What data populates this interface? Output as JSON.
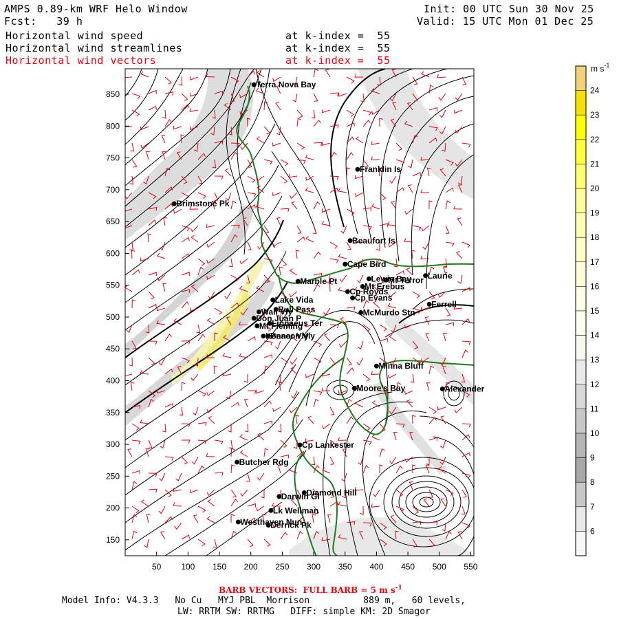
{
  "header": {
    "title_left": "AMPS 0.89-km WRF Helo Window",
    "forecast_left": "Fcst:   39 h",
    "init_right": "Init: 00 UTC Sun 30 Nov 25",
    "valid_right": "Valid: 15 UTC Mon 01 Dec 25",
    "fields": [
      {
        "name": "Horizontal wind speed",
        "level": "at k-index =  55",
        "color": "#000000"
      },
      {
        "name": "Horizontal wind streamlines",
        "level": "at k-index =  55",
        "color": "#000000"
      },
      {
        "name": "Horizontal wind vectors",
        "level": "at k-index =  55",
        "color": "#e8000b"
      }
    ]
  },
  "map": {
    "x_ticks": [
      "50",
      "100",
      "150",
      "200",
      "250",
      "300",
      "350",
      "400",
      "450",
      "500",
      "550"
    ],
    "y_ticks": [
      "150",
      "200",
      "250",
      "300",
      "350",
      "400",
      "450",
      "500",
      "550",
      "600",
      "650",
      "700",
      "750",
      "800",
      "850"
    ],
    "x_range": [
      0,
      555
    ],
    "y_range": [
      125,
      890
    ],
    "coastline_color": "#1f7a1f",
    "streamline_color": "#000000",
    "barb_color": "#e8000b",
    "stations": [
      {
        "name": "Terra Nova Bay",
        "x": 205,
        "y": 865
      },
      {
        "name": "Franklin Is",
        "x": 370,
        "y": 732
      },
      {
        "name": "Brimstone Pk",
        "x": 78,
        "y": 678
      },
      {
        "name": "Beaufort Is",
        "x": 358,
        "y": 620
      },
      {
        "name": "Cape Bird",
        "x": 350,
        "y": 583
      },
      {
        "name": "Lewis Bay",
        "x": 388,
        "y": 560
      },
      {
        "name": "Laurie",
        "x": 478,
        "y": 565
      },
      {
        "name": "Marble Pt",
        "x": 275,
        "y": 556
      },
      {
        "name": "Mt Terror",
        "x": 415,
        "y": 558
      },
      {
        "name": "Cp Royds",
        "x": 354,
        "y": 540
      },
      {
        "name": "Mt Erebus",
        "x": 378,
        "y": 548
      },
      {
        "name": "Cp Evans",
        "x": 362,
        "y": 530
      },
      {
        "name": "Lake Vida",
        "x": 235,
        "y": 527
      },
      {
        "name": "Wall Vly",
        "x": 213,
        "y": 508
      },
      {
        "name": "Ferrell",
        "x": 484,
        "y": 520
      },
      {
        "name": "McMurdo Stn",
        "x": 375,
        "y": 507
      },
      {
        "name": "Bull Pass",
        "x": 240,
        "y": 512
      },
      {
        "name": "Don Juan P",
        "x": 205,
        "y": 498
      },
      {
        "name": "Mt Fleming",
        "x": 210,
        "y": 486
      },
      {
        "name": "Linnaeus Ter",
        "x": 230,
        "y": 490
      },
      {
        "name": "Kennar Vly",
        "x": 220,
        "y": 470
      },
      {
        "name": "Beacon Vly",
        "x": 228,
        "y": 470
      },
      {
        "name": "Minna Bluff",
        "x": 400,
        "y": 423
      },
      {
        "name": "Moore's Bay",
        "x": 365,
        "y": 388
      },
      {
        "name": "Alexander",
        "x": 505,
        "y": 387
      },
      {
        "name": "Cp Lankester",
        "x": 278,
        "y": 299
      },
      {
        "name": "Butcher Rdg",
        "x": 178,
        "y": 272
      },
      {
        "name": "Darwin Gl",
        "x": 245,
        "y": 218
      },
      {
        "name": "Diamond Hill",
        "x": 285,
        "y": 224
      },
      {
        "name": "Lk Wellman",
        "x": 232,
        "y": 196
      },
      {
        "name": "Westhaven Nun",
        "x": 180,
        "y": 178
      },
      {
        "name": "Derrick Pk",
        "x": 228,
        "y": 173
      }
    ]
  },
  "colorbar": {
    "unit": "m s",
    "unit_sup": "-1",
    "labels": [
      "24",
      "23",
      "22",
      "21",
      "20",
      "19",
      "18",
      "17",
      "16",
      "15",
      "14",
      "13",
      "12",
      "11",
      "10",
      "9",
      "8",
      "7",
      "6"
    ],
    "colors": [
      "#f0d27a",
      "#f5e000",
      "#ffff00",
      "#ffff40",
      "#ffff70",
      "#ffff9a",
      "#ffffb0",
      "#ffffc6",
      "#fffed8",
      "#ffffe6",
      "#fffff0",
      "#f7f7f0",
      "#e8e8e8",
      "#d8d8d8",
      "#c8c8c8",
      "#b4b4b4",
      "#a8a8a8",
      "#c8c8c8",
      "#e8e8e8",
      "#f6f6f6"
    ]
  },
  "footer": {
    "barb_note": "BARB VECTORS:  FULL BARB = 5 m s",
    "barb_note_sup": "-1",
    "model_info": "Model Info: V4.3.3   No Cu   MYJ PBL  Morrison          889 m,   60 levels,",
    "model_info2": "LW: RRTM SW: RRTMG   DIFF: simple KM: 2D Smagor"
  }
}
